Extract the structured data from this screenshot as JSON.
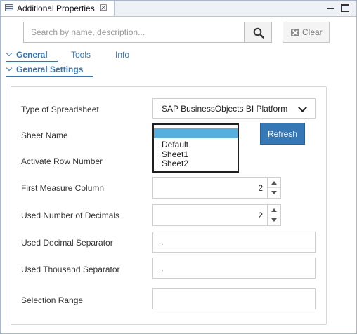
{
  "window": {
    "tab_title": "Additional Properties",
    "close_glyph": "☒",
    "tab_icon": "properties-view-icon"
  },
  "search": {
    "placeholder": "Search by name, description...",
    "value": "",
    "icon": "search-icon",
    "clear_label": "Clear"
  },
  "tabs": [
    {
      "label": "General",
      "active": true
    },
    {
      "label": "Tools",
      "active": false
    },
    {
      "label": "Info",
      "active": false
    }
  ],
  "section": {
    "title": "General Settings"
  },
  "form": {
    "spreadsheet_type": {
      "label": "Type of Spreadsheet",
      "value": "SAP BusinessObjects BI Platform"
    },
    "sheet_name": {
      "label": "Sheet Name",
      "options": [
        "",
        "Default",
        "Sheet1",
        "Sheet2"
      ],
      "selected_index": 0
    },
    "refresh_label": "Refresh",
    "activate_row_number": {
      "label": "Activate Row Number"
    },
    "first_measure_column": {
      "label": "First Measure Column",
      "value": "2"
    },
    "used_decimals": {
      "label": "Used Number of Decimals",
      "value": "2"
    },
    "decimal_separator": {
      "label": "Used Decimal Separator",
      "value": "."
    },
    "thousand_separator": {
      "label": "Used Thousand Separator",
      "value": ","
    },
    "selection_range": {
      "label": "Selection Range",
      "value": ""
    }
  },
  "colors": {
    "accent": "#3a74ad",
    "button_primary": "#3678b5",
    "list_highlight": "#57afe0"
  }
}
